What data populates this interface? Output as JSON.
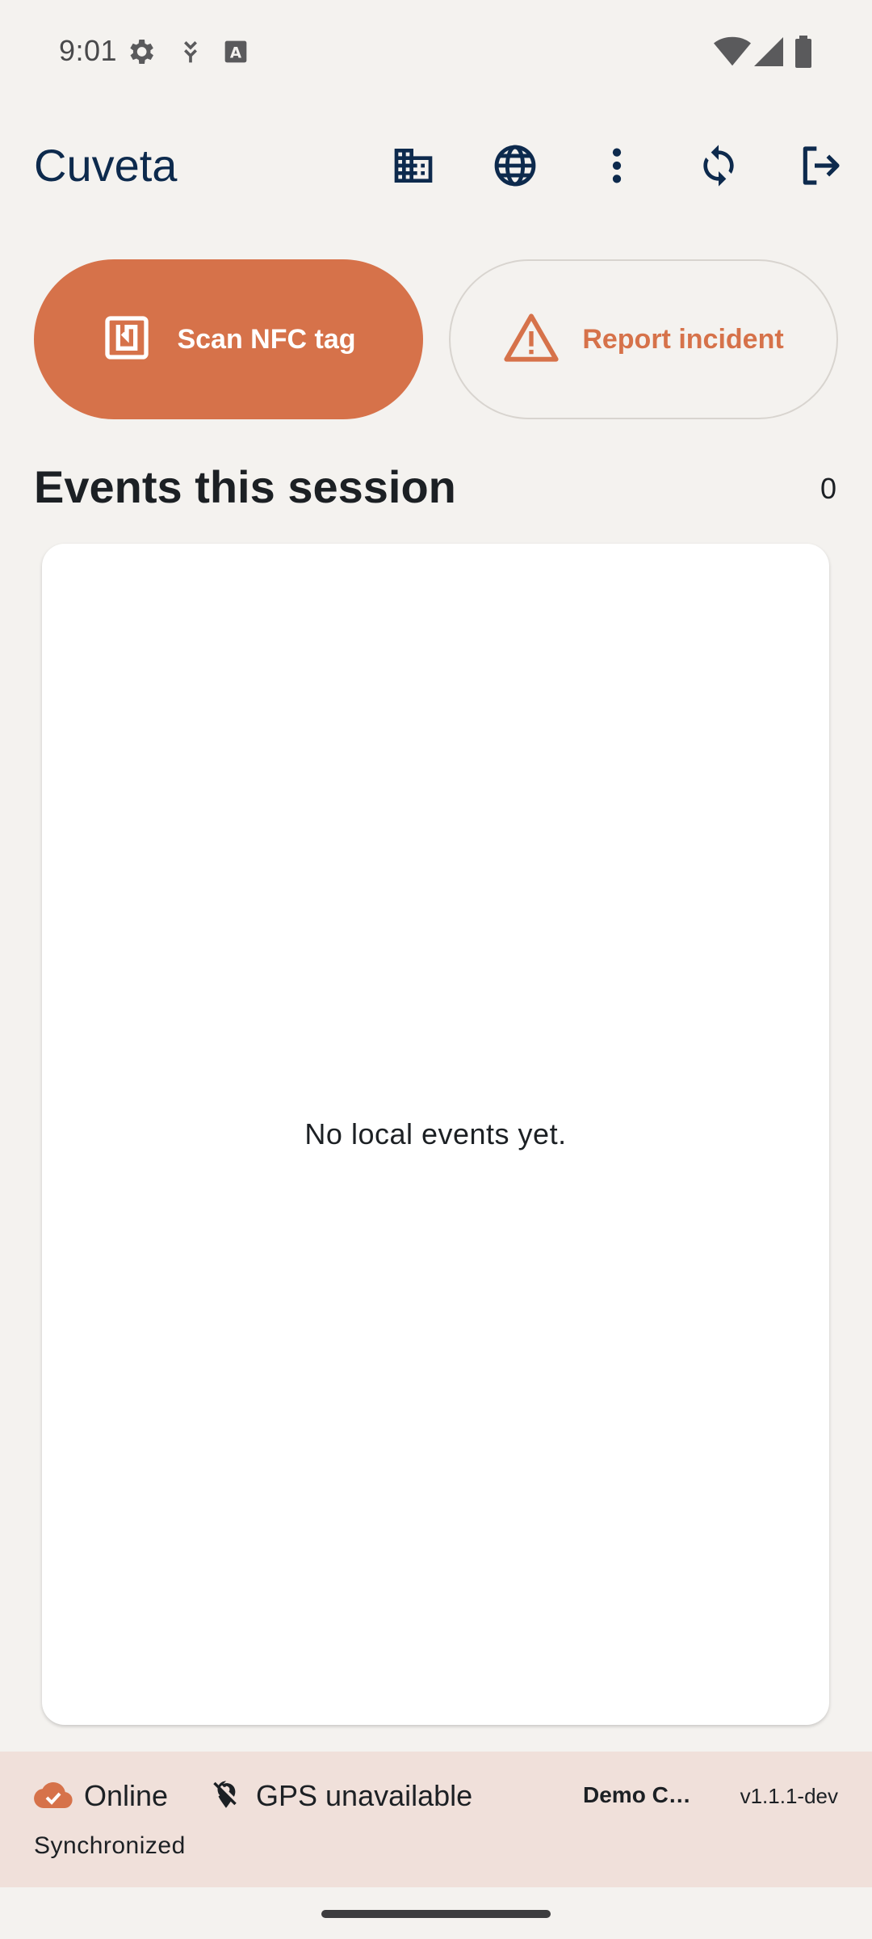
{
  "status_bar": {
    "time": "9:01",
    "left_icons": [
      "settings-gear-icon",
      "download-arrow-icon",
      "keyboard-a-icon"
    ],
    "right_icons": [
      "wifi-icon",
      "cell-signal-icon",
      "battery-icon"
    ]
  },
  "app_bar": {
    "title": "Cuveta",
    "actions": [
      "building-icon",
      "globe-icon",
      "more-vert-icon",
      "sync-icon",
      "logout-icon"
    ],
    "primary_color": "#0d2a4d"
  },
  "actions": {
    "scan_label": "Scan NFC tag",
    "scan_icon": "nfc-icon",
    "report_label": "Report incident",
    "report_icon": "warning-triangle-icon",
    "accent_color": "#d6724a"
  },
  "events": {
    "title": "Events this session",
    "count": "0",
    "empty_message": "No local events yet."
  },
  "footer": {
    "network_status": "Online",
    "network_icon": "cloud-check-icon",
    "gps_status": "GPS unavailable",
    "gps_icon": "location-off-icon",
    "organization": "Demo C…",
    "version": "v1.1.1-dev",
    "sync_status": "Synchronized",
    "background_color": "#f0e0da"
  }
}
